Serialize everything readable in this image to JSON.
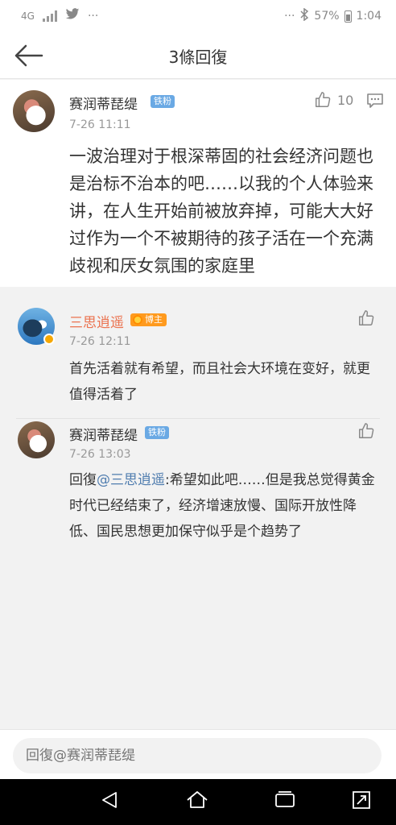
{
  "status_bar": {
    "network": "4G",
    "battery": "57%",
    "time": "1:04",
    "icons": [
      "signal-icon",
      "twitter-icon",
      "more-icon",
      "bluetooth-icon",
      "battery-icon"
    ]
  },
  "header": {
    "title": "3條回復"
  },
  "main_comment": {
    "user": "赛润蒂琵缇",
    "badge": "铁粉",
    "time": "7-26 11:11",
    "likes": "10",
    "text": "一波治理对于根深蒂固的社会经济问题也是治标不治本的吧……以我的个人体验来讲，在人生开始前被放弃掉，可能大大好过作为一个不被期待的孩子活在一个充满歧视和厌女氛围的家庭里"
  },
  "replies": [
    {
      "user": "三思逍遥",
      "badge": "博主",
      "time": "7-26 12:11",
      "text": "首先活着就有希望，而且社会大环境在变好，就更值得活着了"
    },
    {
      "user": "赛润蒂琵缇",
      "badge": "铁粉",
      "time": "7-26 13:03",
      "reply_prefix": "回復",
      "mention": "@三思逍遥",
      "text": ":希望如此吧……但是我总觉得黄金时代已经结束了，经济增速放慢、国际开放性降低、国民思想更加保守似乎是个趋势了"
    }
  ],
  "input": {
    "placeholder": "回復@赛润蒂琵缇"
  },
  "colors": {
    "accent_link": "#507daf",
    "author_name": "#eb7350",
    "badge_blue": "#6aa9e4",
    "badge_gold": "#ff9a1e"
  }
}
